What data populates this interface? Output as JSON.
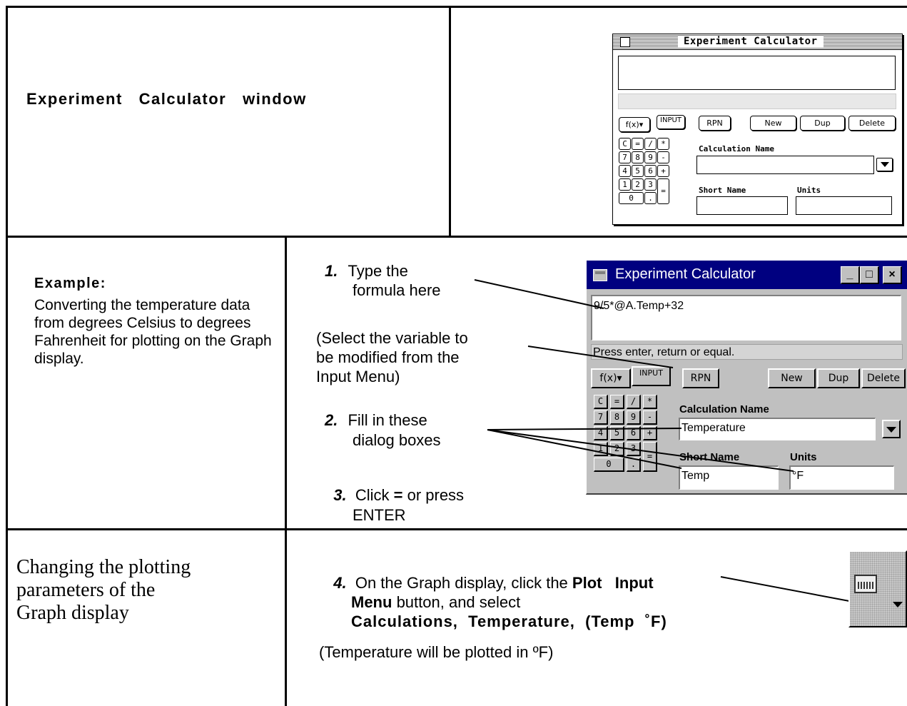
{
  "row1": {
    "heading": "Experiment   Calculator   window"
  },
  "mac_window": {
    "title": "Experiment Calculator",
    "fx_button": "f(x)▾",
    "input_button": "INPUT",
    "rpn_button": "RPN",
    "new_button": "New",
    "dup_button": "Dup",
    "delete_button": "Delete",
    "keypad": [
      "C",
      "=",
      "/",
      "*",
      "7",
      "8",
      "9",
      "-",
      "4",
      "5",
      "6",
      "+",
      "1",
      "2",
      "3",
      "=",
      "0",
      "."
    ],
    "calculation_name_label": "Calculation Name",
    "short_name_label": "Short Name",
    "units_label": "Units"
  },
  "row2": {
    "example_heading": "Example:",
    "example_text": "Converting the temperature data from degrees Celsius to degrees Fahrenheit for plotting on the Graph display.",
    "step1_num": "1.",
    "step1_line1": "Type the",
    "step1_line2": "formula here",
    "select_note_line1": "(Select the variable to",
    "select_note_line2": "be modified from the",
    "select_note_line3": "Input Menu)",
    "step2_num": "2.",
    "step2_line1": "Fill in these",
    "step2_line2": "dialog boxes",
    "step3_num": "3.",
    "step3_pre": "Click ",
    "step3_eq": "=",
    "step3_post": " or press",
    "step3_line2": "ENTER"
  },
  "win_window": {
    "title": "Experiment Calculator",
    "min_button": "_",
    "max_button": "□",
    "close_button": "×",
    "formula": "9/5*@A.Temp+32",
    "status": "Press enter, return or equal.",
    "fx_button": "f(x)▾",
    "input_button": "INPUT",
    "rpn_button": "RPN",
    "new_button": "New",
    "dup_button": "Dup",
    "delete_button": "Delete",
    "keypad": [
      "C",
      "=",
      "/",
      "*",
      "7",
      "8",
      "9",
      "-",
      "4",
      "5",
      "6",
      "+",
      "1",
      "2",
      "3",
      "=",
      "0",
      "."
    ],
    "calculation_name_label": "Calculation Name",
    "calculation_name_value": "Temperature",
    "short_name_label": "Short Name",
    "short_name_value": "Temp",
    "units_label": "Units",
    "units_value": "°F"
  },
  "row3": {
    "heading_line1": "Changing the plotting",
    "heading_line2": "parameters of the",
    "heading_line3": "Graph display",
    "step4_num": "4.",
    "step4_pre": "On the Graph display, click the ",
    "step4_bold1": "Plot   Input",
    "step4_bold2": "Menu",
    "step4_mid": " button, and select",
    "step4_bold3": "Calculations,  Temperature,  (Temp  ˚F)",
    "note": "(Temperature will be plotted in ºF)"
  }
}
